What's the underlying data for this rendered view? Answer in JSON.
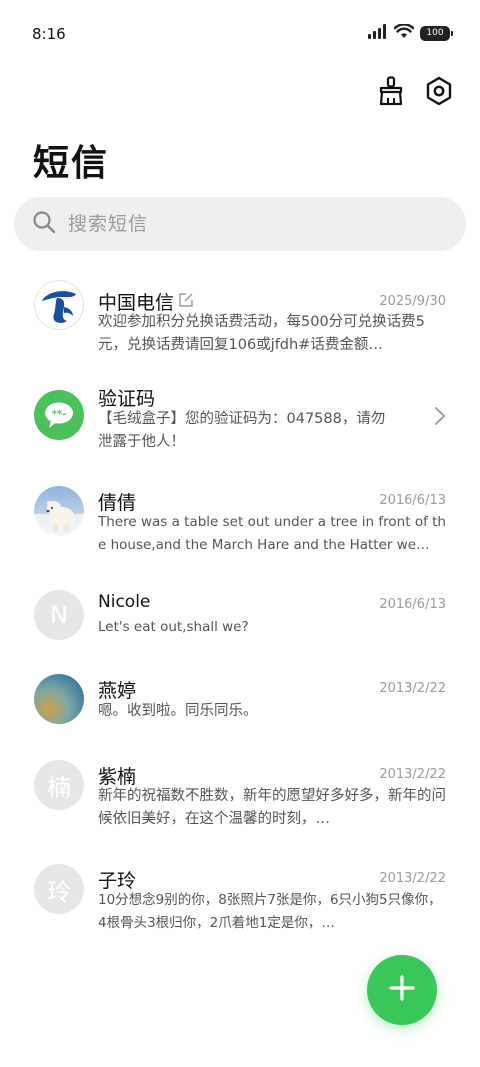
{
  "status_bar": {
    "time": "8:16",
    "battery": "100",
    "icons": [
      "signal-icon",
      "wifi-icon",
      "battery-icon"
    ]
  },
  "header": {
    "title": "短信",
    "actions": [
      "clean-brush-icon",
      "settings-gear-icon"
    ]
  },
  "search": {
    "placeholder": "搜索短信",
    "value": ""
  },
  "conversations": [
    {
      "name": "中国电信",
      "date": "2025/9/30",
      "preview": "欢迎参加积分兑换话费活动，每500分可兑换话费5元，兑换话费请回复106或jfdh#话费金额…",
      "avatar": "china-telecom-logo",
      "has_draft_icon": true
    },
    {
      "name": "验证码",
      "date": "",
      "preview": "【毛绒盒子】您的验证码为：047588，请勿泄露于他人！",
      "avatar": "verification-message-icon",
      "has_chevron": true
    },
    {
      "name": "倩倩",
      "date": "2016/6/13",
      "preview": "There was a table set out under a tree in front of the house,and the March Hare and the Hatter we…",
      "avatar": "polar-bear-photo"
    },
    {
      "name": "Nicole",
      "date": "2016/6/13",
      "preview": "Let's eat out,shall we?",
      "avatar_letter": "N"
    },
    {
      "name": "燕婷",
      "date": "2013/2/22",
      "preview": "嗯。收到啦。同乐同乐。",
      "avatar": "landscape-photo"
    },
    {
      "name": "紫楠",
      "date": "2013/2/22",
      "preview": "新年的祝福数不胜数，新年的愿望好多好多，新年的问候依旧美好，在这个温馨的时刻，…",
      "avatar_letter": "楠"
    },
    {
      "name": "子玲",
      "date": "2013/2/22",
      "preview": "10分想念9别的你，8张照片7张是你，6只小狗5只像你，4根骨头3根归你，2爪着地1定是你，…",
      "avatar_letter": "玲"
    }
  ],
  "fab": {
    "icon": "plus-icon"
  },
  "colors": {
    "accent_green": "#3cc75a",
    "telecom_blue": "#1a4fa0",
    "search_bg": "#efefef",
    "secondary_text": "#9a9a9a"
  }
}
